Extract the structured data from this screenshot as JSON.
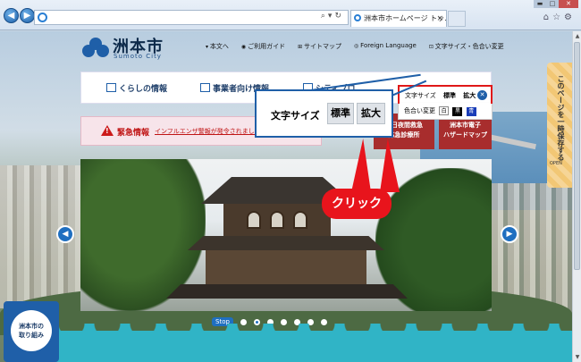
{
  "browser": {
    "tab_title": "洲本市ホームページ トッ...",
    "tab_close": "×"
  },
  "header": {
    "logo_text": "洲本市",
    "logo_sub": "Sumoto City",
    "links": [
      "本文へ",
      "ご利用ガイド",
      "サイトマップ",
      "Foreign Language",
      "文字サイズ・色合い変更"
    ]
  },
  "text_settings": {
    "size_label": "文字サイズ",
    "standard": "標準",
    "large": "拡大",
    "color_label": "色合い変更",
    "colors": [
      "白",
      "黒",
      "青"
    ]
  },
  "main_nav": {
    "items": [
      "くらしの情報",
      "事業者向け情報",
      "シティプロ"
    ]
  },
  "emergency": {
    "title": "緊急情報",
    "link": "インフルエンザ警報が発令されました"
  },
  "red_buttons": [
    [
      "休日夜間救急",
      "応急診療所"
    ],
    [
      "洲本市電子",
      "ハザードマップ"
    ]
  ],
  "slider": {
    "stop": "Stop"
  },
  "torikumi": [
    "洲本市の",
    "取り組み"
  ],
  "side_tab": {
    "text": "このページを一時保存する",
    "open": "OPEN"
  },
  "callout": {
    "label": "文字サイズ",
    "standard": "標準",
    "large": "拡大",
    "click": "クリック"
  }
}
